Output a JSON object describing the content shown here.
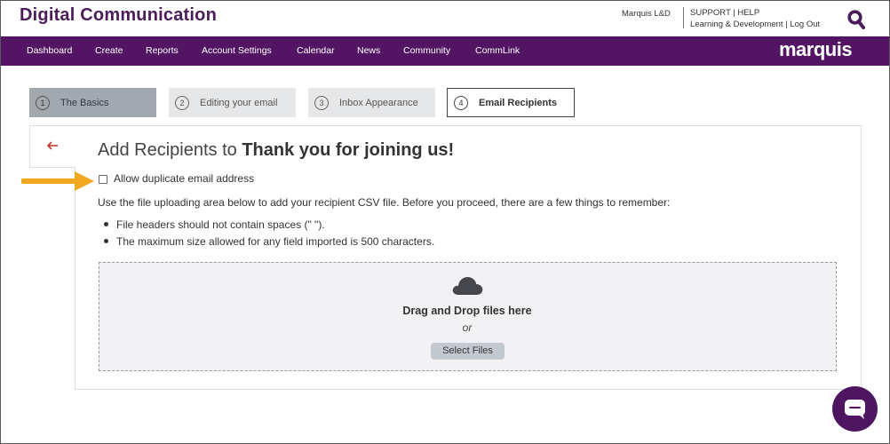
{
  "header": {
    "app_title": "Digital Communication",
    "account_name": "Marquis L&D",
    "support_label": "SUPPORT",
    "help_label": "HELP",
    "learning_label": "Learning & Development",
    "logout_label": "Log Out",
    "separator": "|",
    "search_icon": "search-icon"
  },
  "nav": {
    "items": [
      {
        "label": "Dashboard"
      },
      {
        "label": "Create"
      },
      {
        "label": "Reports"
      },
      {
        "label": "Account Settings"
      },
      {
        "label": "Calendar"
      },
      {
        "label": "News"
      },
      {
        "label": "Community"
      },
      {
        "label": "CommLink"
      }
    ],
    "brand": "marquis"
  },
  "steps": [
    {
      "number": "1",
      "label": "The Basics",
      "state": "completed"
    },
    {
      "number": "2",
      "label": "Editing your email",
      "state": "inactive"
    },
    {
      "number": "3",
      "label": "Inbox Appearance",
      "state": "inactive"
    },
    {
      "number": "4",
      "label": "Email Recipients",
      "state": "active"
    }
  ],
  "main": {
    "back_icon": "arrow-left-icon",
    "title_prefix": "Add Recipients to",
    "title_name": "Thank you for joining us!",
    "checkbox_label": "Allow duplicate email address",
    "checkbox_checked": false,
    "description": "Use the file uploading area below to add your recipient CSV file. Before you proceed, there are a few things to remember:",
    "bullets": [
      "File headers should not contain spaces (\" \").",
      "The maximum size allowed for any field imported is 500 characters."
    ],
    "dropzone": {
      "icon": "cloud-icon",
      "main_text": "Drag and Drop files here",
      "or_text": "or",
      "button_label": "Select Files"
    }
  },
  "chat": {
    "icon": "chat-icon"
  },
  "colors": {
    "brand_purple": "#521463",
    "title_purple": "#4c1c5a",
    "accent_arrow": "#f0a823",
    "back_arrow": "#c0392b"
  }
}
